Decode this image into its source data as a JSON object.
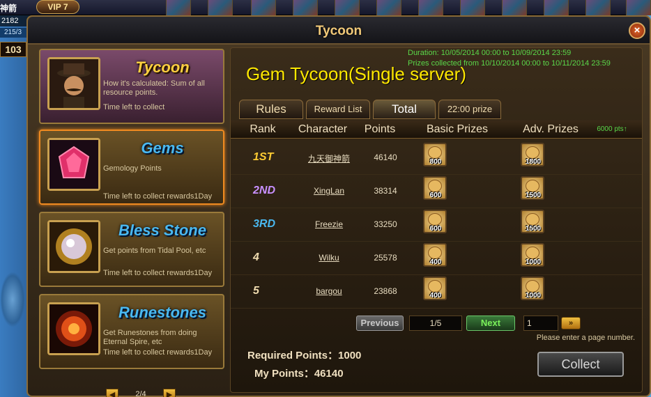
{
  "hud": {
    "vip_label": "VIP 7",
    "player_name": "神箭",
    "gem_count": "2182",
    "hp": "215/3",
    "level": "103"
  },
  "window": {
    "title": "Tycoon",
    "close_label": "×"
  },
  "left_cards": [
    {
      "title": "Tycoon",
      "desc": "How it's calculated: Sum of all resource points.",
      "time": "Time left to collect",
      "icon": "mustache-man-icon"
    },
    {
      "title": "Gems",
      "desc": "Gemology Points",
      "time": "Time left to collect rewards1Day",
      "icon": "red-gem-icon"
    },
    {
      "title": "Bless Stone",
      "desc": "Get points from Tidal Pool, etc",
      "time": "Time left to collect rewards1Day",
      "icon": "pearl-icon"
    },
    {
      "title": "Runestones",
      "desc": "Get Runestones from doing Eternal Spire, etc",
      "time": "Time left to collect rewards1Day",
      "icon": "fire-rune-icon"
    }
  ],
  "left_pager": {
    "text": "2/4",
    "prev": "◀",
    "next": "▶"
  },
  "event": {
    "duration": "Duration: 10/05/2014 00:00 to 10/09/2014 23:59",
    "prizes_collected": "Prizes collected from 10/10/2014 00:00 to 10/11/2014 23:59",
    "title": "Gem Tycoon(Single server)"
  },
  "tabs": [
    {
      "label": "Rules"
    },
    {
      "label": "Reward List"
    },
    {
      "label": "Total"
    },
    {
      "label": "22:00 prize"
    }
  ],
  "table": {
    "headers": {
      "rank": "Rank",
      "character": "Character",
      "points": "Points",
      "basic": "Basic Prizes",
      "adv": "Adv. Prizes",
      "adv_note": "6000 pts↑"
    },
    "rows": [
      {
        "rank": "1ST",
        "character": "九天御神箭",
        "points": "46140",
        "basic": "800",
        "adv": "1800",
        "rank_color": "#ffcc33"
      },
      {
        "rank": "2ND",
        "character": "XingLan",
        "points": "38314",
        "basic": "600",
        "adv": "1500",
        "rank_color": "#c890ff"
      },
      {
        "rank": "3RD",
        "character": "Freezie",
        "points": "33250",
        "basic": "600",
        "adv": "1500",
        "rank_color": "#4ab8f0"
      },
      {
        "rank": "4",
        "character": "Wilku",
        "points": "25578",
        "basic": "400",
        "adv": "1000",
        "rank_color": "#f0dcb0"
      },
      {
        "rank": "5",
        "character": "bargou",
        "points": "23868",
        "basic": "400",
        "adv": "1000",
        "rank_color": "#f0dcb0"
      }
    ]
  },
  "pager": {
    "prev": "Previous",
    "page": "1/5",
    "next": "Next",
    "input_value": "1",
    "go": "»",
    "hint": "Please enter a page number."
  },
  "footer": {
    "required": "Required Points：1000",
    "mine": "My Points：46140",
    "collect": "Collect"
  }
}
